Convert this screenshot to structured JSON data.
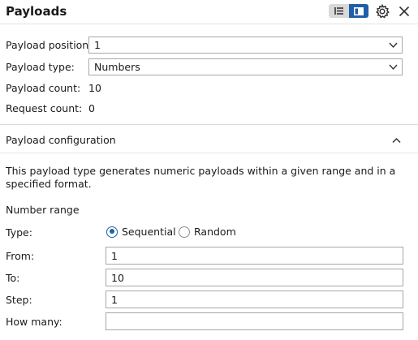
{
  "header": {
    "title": "Payloads",
    "view_toggle": {
      "left_icon": "list-view-icon",
      "right_icon": "panel-view-icon",
      "active": "right"
    },
    "settings_icon": "gear-icon",
    "close_icon": "close-icon"
  },
  "payload_sets": {
    "position_label": "Payload position:",
    "position_value": "1",
    "type_label": "Payload type:",
    "type_value": "Numbers",
    "payload_count_label": "Payload count:",
    "payload_count_value": "10",
    "request_count_label": "Request count:",
    "request_count_value": "0"
  },
  "config": {
    "section_title": "Payload configuration",
    "collapse_icon": "chevron-up-icon",
    "description": "This payload type generates numeric payloads within a given range and in a specified format.",
    "range_heading": "Number range",
    "type_label": "Type:",
    "type_options": [
      {
        "label": "Sequential",
        "selected": true
      },
      {
        "label": "Random",
        "selected": false
      }
    ],
    "from_label": "From:",
    "from_value": "1",
    "to_label": "To:",
    "to_value": "10",
    "step_label": "Step:",
    "step_value": "1",
    "how_many_label": "How many:",
    "how_many_value": ""
  },
  "colors": {
    "accent": "#1e5fa8",
    "border": "#a8a8a8",
    "text": "#1a1a1a"
  }
}
